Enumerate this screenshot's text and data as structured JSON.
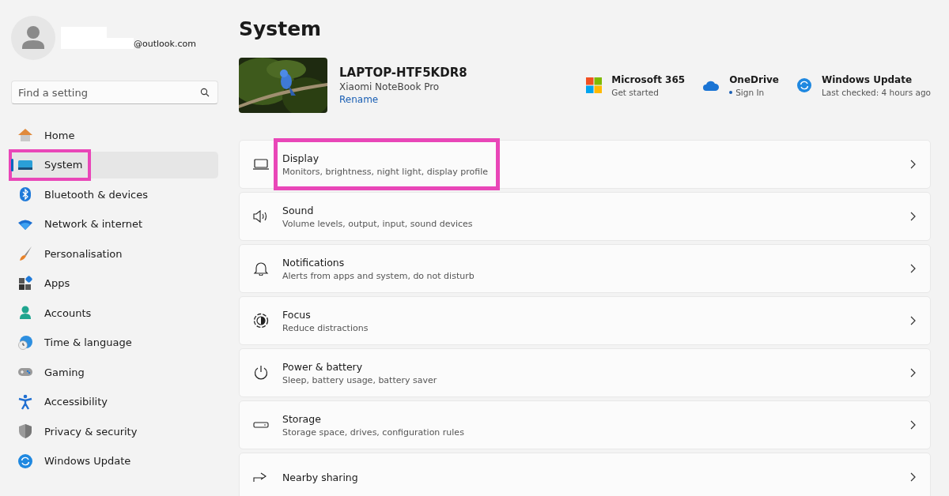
{
  "account": {
    "email": "@outlook.com"
  },
  "search": {
    "placeholder": "Find a setting"
  },
  "nav": [
    {
      "label": "Home",
      "selected": false,
      "annotated": false
    },
    {
      "label": "System",
      "selected": true,
      "annotated": true
    },
    {
      "label": "Bluetooth & devices",
      "selected": false,
      "annotated": false
    },
    {
      "label": "Network & internet",
      "selected": false,
      "annotated": false
    },
    {
      "label": "Personalisation",
      "selected": false,
      "annotated": false
    },
    {
      "label": "Apps",
      "selected": false,
      "annotated": false
    },
    {
      "label": "Accounts",
      "selected": false,
      "annotated": false
    },
    {
      "label": "Time & language",
      "selected": false,
      "annotated": false
    },
    {
      "label": "Gaming",
      "selected": false,
      "annotated": false
    },
    {
      "label": "Accessibility",
      "selected": false,
      "annotated": false
    },
    {
      "label": "Privacy & security",
      "selected": false,
      "annotated": false
    },
    {
      "label": "Windows Update",
      "selected": false,
      "annotated": false
    }
  ],
  "page": {
    "title": "System"
  },
  "device": {
    "name": "LAPTOP-HTF5KDR8",
    "model": "Xiaomi NoteBook Pro",
    "rename": "Rename"
  },
  "services": [
    {
      "title": "Microsoft 365",
      "subtitle": "Get started",
      "dot": false
    },
    {
      "title": "OneDrive",
      "subtitle": "Sign In",
      "dot": true
    },
    {
      "title": "Windows Update",
      "subtitle": "Last checked: 4 hours ago",
      "dot": false
    }
  ],
  "settings": [
    {
      "title": "Display",
      "description": "Monitors, brightness, night light, display profile",
      "annotated": true
    },
    {
      "title": "Sound",
      "description": "Volume levels, output, input, sound devices",
      "annotated": false
    },
    {
      "title": "Notifications",
      "description": "Alerts from apps and system, do not disturb",
      "annotated": false
    },
    {
      "title": "Focus",
      "description": "Reduce distractions",
      "annotated": false
    },
    {
      "title": "Power & battery",
      "description": "Sleep, battery usage, battery saver",
      "annotated": false
    },
    {
      "title": "Storage",
      "description": "Storage space, drives, configuration rules",
      "annotated": false
    },
    {
      "title": "Nearby sharing",
      "annotated": false
    }
  ]
}
